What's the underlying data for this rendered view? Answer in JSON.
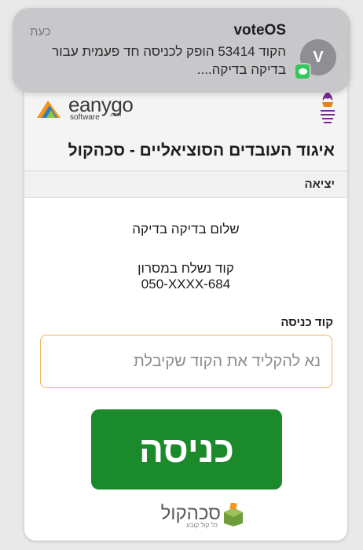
{
  "notification": {
    "app_initial": "V",
    "title": "voteOS",
    "time": "כעת",
    "body": "הקוד 53414 הופק לכניסה חד פעמית עבור בדיקה בדיקה....",
    "badge_icon": "messages-icon"
  },
  "header": {
    "logo_left_wordmark": "eanygo",
    "logo_left_sub": "software",
    "logo_left_subcom": ".com",
    "org_title": "איגוד העובדים הסוציאליים - סכהקול"
  },
  "nav": {
    "exit_label": "יציאה"
  },
  "main": {
    "greeting": "שלום בדיקה בדיקה",
    "sent_label": "קוד נשלח במסרון",
    "phone": "050-XXXX-684",
    "code_label": "קוד כניסה",
    "code_placeholder": "נא להקליד את הקוד שקיבלת",
    "code_value": "",
    "enter_button": "כניסה"
  },
  "footer": {
    "brand_name": "סכהקול",
    "brand_tagline": "כל קול קובע"
  },
  "colors": {
    "accent_green": "#1b8a2b",
    "input_border": "#f2b35a",
    "notification_bg": "#c8c8ca",
    "message_badge": "#34c759"
  }
}
